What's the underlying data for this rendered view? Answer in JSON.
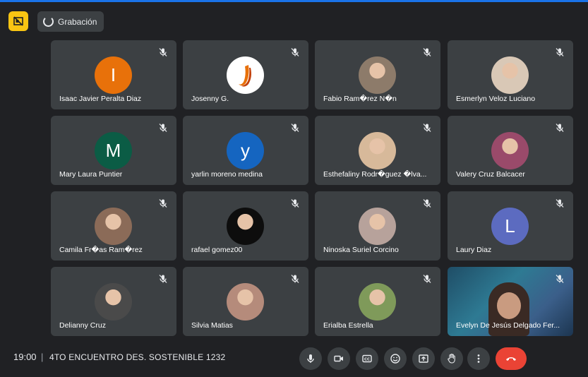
{
  "recording": {
    "label": "Grabación"
  },
  "participants": [
    {
      "name": "Isaac Javier Peralta Diaz",
      "initial": "I",
      "color": "#e8710a",
      "kind": "letter"
    },
    {
      "name": "Josenny G.",
      "initial": "J",
      "color": "#ffffff",
      "kind": "logo"
    },
    {
      "name": "Fabio Ram�rez N�n",
      "initial": "",
      "color": "#8d7b6a",
      "kind": "photo"
    },
    {
      "name": "Esmerlyn Veloz Luciano",
      "initial": "",
      "color": "#d9c8b6",
      "kind": "photo"
    },
    {
      "name": "Mary Laura Puntier",
      "initial": "M",
      "color": "#0b5c45",
      "kind": "letter"
    },
    {
      "name": "yarlin moreno medina",
      "initial": "y",
      "color": "#1565c0",
      "kind": "letter"
    },
    {
      "name": "Esthefaliny Rodr�guez �lva...",
      "initial": "",
      "color": "#d7b99a",
      "kind": "photo"
    },
    {
      "name": "Valery Cruz Balcacer",
      "initial": "",
      "color": "#9a4a6a",
      "kind": "photo"
    },
    {
      "name": "Camila Fr�as Ram�rez",
      "initial": "",
      "color": "#8b6b58",
      "kind": "photo"
    },
    {
      "name": "rafael gomez00",
      "initial": "",
      "color": "#0d0d0d",
      "kind": "photo"
    },
    {
      "name": "Ninoska Suriel Corcino",
      "initial": "",
      "color": "#b7a29b",
      "kind": "photo"
    },
    {
      "name": "Laury Diaz",
      "initial": "L",
      "color": "#5c6bc0",
      "kind": "letter"
    },
    {
      "name": "Delianny Cruz",
      "initial": "",
      "color": "#4a4a4a",
      "kind": "photo"
    },
    {
      "name": "Silvia Matias",
      "initial": "",
      "color": "#b58b7b",
      "kind": "photo"
    },
    {
      "name": "Erialba Estrella",
      "initial": "",
      "color": "#7f9a5a",
      "kind": "photo"
    },
    {
      "name": "Evelyn De Jesús Delgado Fer...",
      "initial": "",
      "color": "#2c5f7a",
      "kind": "video"
    }
  ],
  "meeting": {
    "time": "19:00",
    "separator": "|",
    "title": "4TO ENCUENTRO DES. SOSTENIBLE 1232"
  },
  "controls": [
    {
      "name": "mic-button",
      "icon": "mic-icon"
    },
    {
      "name": "camera-button",
      "icon": "camera-off-icon"
    },
    {
      "name": "captions-button",
      "icon": "captions-icon"
    },
    {
      "name": "reactions-button",
      "icon": "emoji-icon"
    },
    {
      "name": "present-button",
      "icon": "present-screen-icon"
    },
    {
      "name": "raise-hand-button",
      "icon": "hand-icon"
    },
    {
      "name": "more-options-button",
      "icon": "more-vert-icon"
    },
    {
      "name": "leave-call-button",
      "icon": "call-end-icon"
    }
  ],
  "colors": {
    "background": "#202124",
    "tile": "#3c4043",
    "accent": "#1a73e8",
    "end_call": "#ea4335",
    "recording": "#f9c513"
  }
}
